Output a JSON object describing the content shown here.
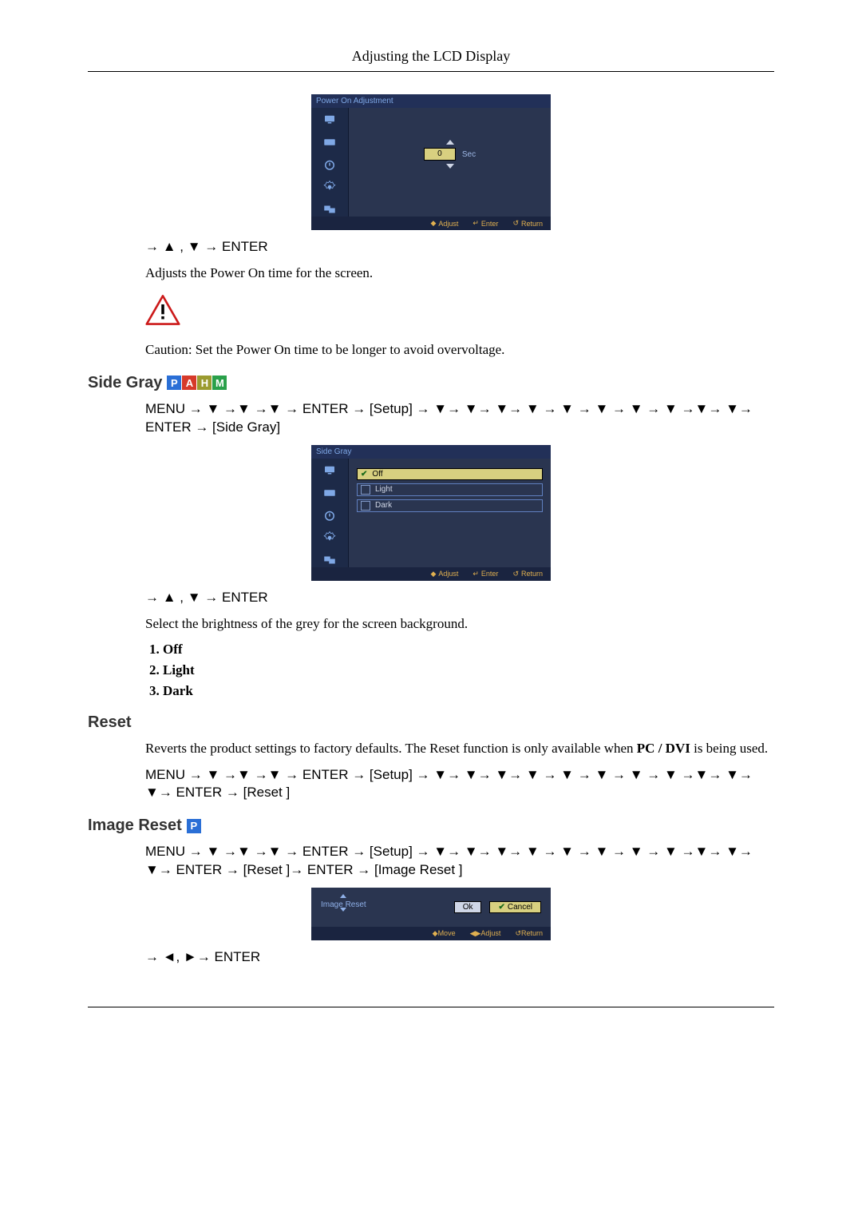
{
  "header": {
    "title": "Adjusting the LCD Display"
  },
  "poa_osd": {
    "title": "Power On Adjustment",
    "value": "0",
    "unit": "Sec",
    "footer": {
      "adjust": "Adjust",
      "enter": "Enter",
      "return": "Return"
    }
  },
  "poa_nav": "→ ▲ , ▼ → ENTER",
  "poa_desc": "Adjusts the Power On time for the screen.",
  "poa_caution": "Caution: Set the Power On time to be longer to avoid overvoltage.",
  "sidegray": {
    "heading": "Side Gray",
    "badges": [
      "P",
      "A",
      "H",
      "M"
    ],
    "menu": "MENU → ▼ →▼ →▼ → ENTER → [Setup] → ▼→ ▼→ ▼→ ▼ → ▼ → ▼ → ▼ → ▼ →▼→ ▼→ ENTER → [Side Gray]",
    "osd_title": "Side Gray",
    "options": [
      "Off",
      "Light",
      "Dark"
    ],
    "footer": {
      "adjust": "Adjust",
      "enter": "Enter",
      "return": "Return"
    },
    "nav": "→ ▲ , ▼ → ENTER",
    "desc": "Select the brightness of the grey for the screen background.",
    "list": [
      "Off",
      "Light",
      "Dark"
    ]
  },
  "reset": {
    "heading": "Reset",
    "desc_a": "Reverts the product settings to factory defaults. The Reset function is only available when ",
    "desc_b": "PC / DVI",
    "desc_c": " is being used.",
    "menu": "MENU → ▼ →▼ →▼ → ENTER → [Setup] → ▼→ ▼→ ▼→ ▼ → ▼ → ▼ → ▼ → ▼ →▼→ ▼→ ▼→ ENTER → [Reset ]"
  },
  "imgreset": {
    "heading": "Image Reset",
    "badges": [
      "P"
    ],
    "menu": "MENU → ▼ →▼ →▼ → ENTER → [Setup] → ▼→ ▼→ ▼→ ▼ → ▼ → ▼ → ▼ → ▼ →▼→ ▼→ ▼→ ENTER → [Reset ]→ ENTER → [Image Reset ]",
    "dialog": {
      "title": "Image Reset",
      "ok": "Ok",
      "cancel": "Cancel",
      "footer": {
        "move": "Move",
        "adjust": "Adjust",
        "return": "Return"
      }
    },
    "nav": "→ ◄, ►→ ENTER"
  }
}
